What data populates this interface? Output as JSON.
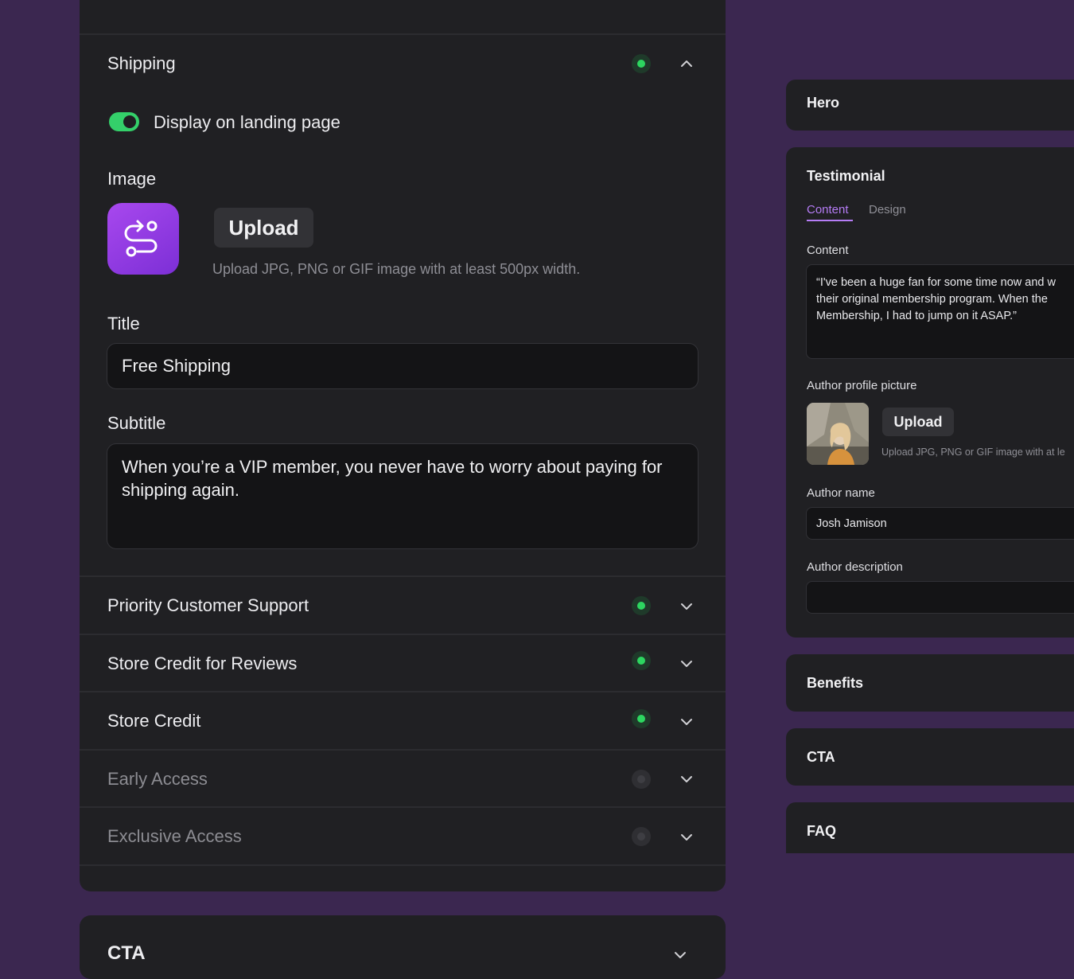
{
  "left_panel": {
    "shipping": {
      "title": "Shipping",
      "status": "active",
      "toggle_label": "Display on landing page",
      "image_label": "Image",
      "upload_label": "Upload",
      "upload_hint": "Upload JPG, PNG or GIF image with at least 500px width.",
      "title_label": "Title",
      "title_value": "Free Shipping",
      "subtitle_label": "Subtitle",
      "subtitle_value": "When you’re a VIP member, you never have to worry about paying for shipping again."
    },
    "items": [
      {
        "title": "Priority Customer Support",
        "status": "active"
      },
      {
        "title": "Store Credit for Reviews",
        "status": "active"
      },
      {
        "title": "Store Credit",
        "status": "active"
      },
      {
        "title": "Early Access",
        "status": "inactive"
      },
      {
        "title": "Exclusive Access",
        "status": "inactive"
      }
    ],
    "cta_title": "CTA"
  },
  "right_panel": {
    "hero_title": "Hero",
    "testimonial": {
      "title": "Testimonial",
      "tabs": [
        "Content",
        "Design"
      ],
      "content_label": "Content",
      "content_value": [
        "“I've been a huge fan for some time now and w",
        "their original membership program. When the",
        "Membership, I had to jump on it ASAP.”"
      ],
      "author_picture_label": "Author profile picture",
      "upload_label": "Upload",
      "upload_hint": "Upload JPG, PNG or GIF image with at le",
      "author_name_label": "Author name",
      "author_name_value": "Josh Jamison",
      "author_description_label": "Author description",
      "author_description_value": ""
    },
    "benefits_title": "Benefits",
    "cta_title": "CTA",
    "faq_title": "FAQ"
  },
  "colors": {
    "background": "#3b2750",
    "panel": "#202023",
    "accent_green": "#34d06a",
    "accent_purple": "#b57cf5"
  }
}
